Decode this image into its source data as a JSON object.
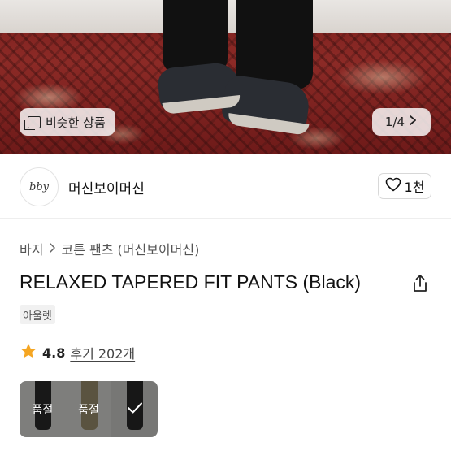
{
  "hero": {
    "similar_label": "비슷한 상품",
    "pager": "1/4"
  },
  "seller": {
    "avatar_text": "bby",
    "name": "머신보이머신",
    "like_count": "1천"
  },
  "product": {
    "breadcrumb": [
      "바지",
      "코튼 팬츠 (머신보이머신)"
    ],
    "title": "RELAXED TAPERED FIT PANTS (Black)",
    "tag": "아울렛",
    "rating": "4.8",
    "reviews": "후기 202개"
  },
  "thumbnails": [
    {
      "label": "품절",
      "color": "dark"
    },
    {
      "label": "품절",
      "color": "khaki"
    },
    {
      "label": "",
      "color": "dark",
      "selected": true
    }
  ],
  "colors": {
    "star": "#f5a623"
  }
}
